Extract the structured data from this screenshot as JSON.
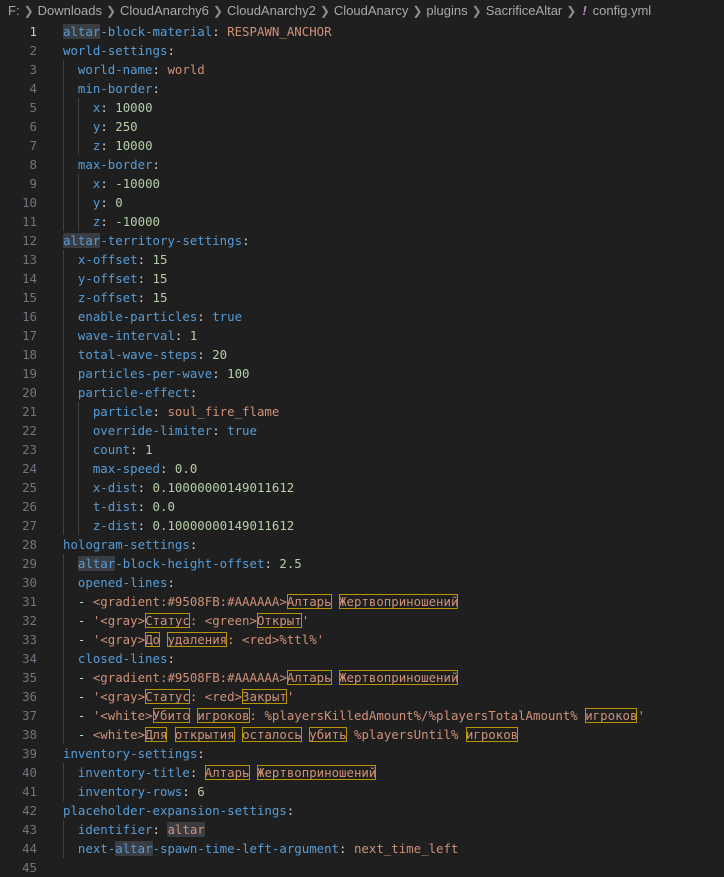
{
  "breadcrumb": {
    "items": [
      "F:",
      "Downloads",
      "CloudAnarchy6",
      "CloudAnarchy2",
      "CloudAnarcy",
      "plugins",
      "SacrificeAltar"
    ],
    "file_icon": "!",
    "file_name": "config.yml"
  },
  "colors": {
    "key": "#569cd6",
    "string": "#ce9178",
    "number": "#b5cea8",
    "punctuation": "#cccccc",
    "highlight_box": "#b89500",
    "background": "#1f1f1f"
  },
  "editor": {
    "active_line": 1,
    "lines": [
      {
        "n": "1",
        "indent": 0,
        "t": [
          [
            "k",
            "altar",
            "hl"
          ],
          [
            "k",
            "-block-material"
          ],
          [
            "p",
            ": "
          ],
          [
            "s",
            "RESPAWN_ANCHOR"
          ]
        ]
      },
      {
        "n": "2",
        "indent": 0,
        "t": [
          [
            "k",
            "world-settings"
          ],
          [
            "p",
            ":"
          ]
        ]
      },
      {
        "n": "3",
        "indent": 1,
        "t": [
          [
            "k",
            "world-name"
          ],
          [
            "p",
            ": "
          ],
          [
            "s",
            "world"
          ]
        ]
      },
      {
        "n": "4",
        "indent": 1,
        "t": [
          [
            "k",
            "min-border"
          ],
          [
            "p",
            ":"
          ]
        ]
      },
      {
        "n": "5",
        "indent": 2,
        "t": [
          [
            "k",
            "x"
          ],
          [
            "p",
            ": "
          ],
          [
            "n",
            "10000"
          ]
        ]
      },
      {
        "n": "6",
        "indent": 2,
        "t": [
          [
            "k",
            "y"
          ],
          [
            "p",
            ": "
          ],
          [
            "n",
            "250"
          ]
        ]
      },
      {
        "n": "7",
        "indent": 2,
        "t": [
          [
            "k",
            "z"
          ],
          [
            "p",
            ": "
          ],
          [
            "n",
            "10000"
          ]
        ]
      },
      {
        "n": "8",
        "indent": 1,
        "t": [
          [
            "k",
            "max-border"
          ],
          [
            "p",
            ":"
          ]
        ]
      },
      {
        "n": "9",
        "indent": 2,
        "t": [
          [
            "k",
            "x"
          ],
          [
            "p",
            ": "
          ],
          [
            "n",
            "-10000"
          ]
        ]
      },
      {
        "n": "10",
        "indent": 2,
        "t": [
          [
            "k",
            "y"
          ],
          [
            "p",
            ": "
          ],
          [
            "n",
            "0"
          ]
        ]
      },
      {
        "n": "11",
        "indent": 2,
        "t": [
          [
            "k",
            "z"
          ],
          [
            "p",
            ": "
          ],
          [
            "n",
            "-10000"
          ]
        ]
      },
      {
        "n": "12",
        "indent": 0,
        "t": [
          [
            "k",
            "altar",
            "hl"
          ],
          [
            "k",
            "-territory-settings"
          ],
          [
            "p",
            ":"
          ]
        ]
      },
      {
        "n": "13",
        "indent": 1,
        "t": [
          [
            "k",
            "x-offset"
          ],
          [
            "p",
            ": "
          ],
          [
            "n",
            "15"
          ]
        ]
      },
      {
        "n": "14",
        "indent": 1,
        "t": [
          [
            "k",
            "y-offset"
          ],
          [
            "p",
            ": "
          ],
          [
            "n",
            "15"
          ]
        ]
      },
      {
        "n": "15",
        "indent": 1,
        "t": [
          [
            "k",
            "z-offset"
          ],
          [
            "p",
            ": "
          ],
          [
            "n",
            "15"
          ]
        ]
      },
      {
        "n": "16",
        "indent": 1,
        "t": [
          [
            "k",
            "enable-particles"
          ],
          [
            "p",
            ": "
          ],
          [
            "b",
            "true"
          ]
        ]
      },
      {
        "n": "17",
        "indent": 1,
        "t": [
          [
            "k",
            "wave-interval"
          ],
          [
            "p",
            ": "
          ],
          [
            "n",
            "1"
          ]
        ]
      },
      {
        "n": "18",
        "indent": 1,
        "t": [
          [
            "k",
            "total-wave-steps"
          ],
          [
            "p",
            ": "
          ],
          [
            "n",
            "20"
          ]
        ]
      },
      {
        "n": "19",
        "indent": 1,
        "t": [
          [
            "k",
            "particles-per-wave"
          ],
          [
            "p",
            ": "
          ],
          [
            "n",
            "100"
          ]
        ]
      },
      {
        "n": "20",
        "indent": 1,
        "t": [
          [
            "k",
            "particle-effect"
          ],
          [
            "p",
            ":"
          ]
        ]
      },
      {
        "n": "21",
        "indent": 2,
        "t": [
          [
            "k",
            "particle"
          ],
          [
            "p",
            ": "
          ],
          [
            "s",
            "soul_fire_flame"
          ]
        ]
      },
      {
        "n": "22",
        "indent": 2,
        "t": [
          [
            "k",
            "override-limiter"
          ],
          [
            "p",
            ": "
          ],
          [
            "b",
            "true"
          ]
        ]
      },
      {
        "n": "23",
        "indent": 2,
        "t": [
          [
            "k",
            "count"
          ],
          [
            "p",
            ": "
          ],
          [
            "n",
            "1"
          ]
        ]
      },
      {
        "n": "24",
        "indent": 2,
        "t": [
          [
            "k",
            "max-speed"
          ],
          [
            "p",
            ": "
          ],
          [
            "n",
            "0.0"
          ]
        ]
      },
      {
        "n": "25",
        "indent": 2,
        "t": [
          [
            "k",
            "x-dist"
          ],
          [
            "p",
            ": "
          ],
          [
            "n",
            "0.10000000149011612"
          ]
        ]
      },
      {
        "n": "26",
        "indent": 2,
        "t": [
          [
            "k",
            "t-dist"
          ],
          [
            "p",
            ": "
          ],
          [
            "n",
            "0.0"
          ]
        ]
      },
      {
        "n": "27",
        "indent": 2,
        "t": [
          [
            "k",
            "z-dist"
          ],
          [
            "p",
            ": "
          ],
          [
            "n",
            "0.10000000149011612"
          ]
        ]
      },
      {
        "n": "28",
        "indent": 0,
        "t": [
          [
            "k",
            "hologram-settings"
          ],
          [
            "p",
            ":"
          ]
        ]
      },
      {
        "n": "29",
        "indent": 1,
        "t": [
          [
            "k",
            "altar",
            "hl"
          ],
          [
            "k",
            "-block-height-offset"
          ],
          [
            "p",
            ": "
          ],
          [
            "n",
            "2.5"
          ]
        ]
      },
      {
        "n": "30",
        "indent": 1,
        "t": [
          [
            "k",
            "opened-lines"
          ],
          [
            "p",
            ":"
          ]
        ]
      },
      {
        "n": "31",
        "indent": 1,
        "t": [
          [
            "p",
            "- "
          ],
          [
            "s",
            "<gradient:#9508FB:#AAAAAA>"
          ],
          [
            "s",
            "Алтарь",
            "box"
          ],
          [
            "s",
            " "
          ],
          [
            "s",
            "Жертвоприношений",
            "box"
          ]
        ]
      },
      {
        "n": "32",
        "indent": 1,
        "t": [
          [
            "p",
            "- "
          ],
          [
            "s",
            "'<gray>"
          ],
          [
            "s",
            "Статус",
            "box"
          ],
          [
            "s",
            ": <green>"
          ],
          [
            "s",
            "Открыт",
            "box"
          ],
          [
            "s",
            "'"
          ]
        ]
      },
      {
        "n": "33",
        "indent": 1,
        "t": [
          [
            "p",
            "- "
          ],
          [
            "s",
            "'<gray>"
          ],
          [
            "s",
            "До",
            "box"
          ],
          [
            "s",
            " "
          ],
          [
            "s",
            "удаления",
            "box"
          ],
          [
            "s",
            ": <red>%ttl%'"
          ]
        ]
      },
      {
        "n": "34",
        "indent": 1,
        "t": [
          [
            "k",
            "closed-lines"
          ],
          [
            "p",
            ":"
          ]
        ]
      },
      {
        "n": "35",
        "indent": 1,
        "t": [
          [
            "p",
            "- "
          ],
          [
            "s",
            "<gradient:#9508FB:#AAAAAA>"
          ],
          [
            "s",
            "Алтарь",
            "box"
          ],
          [
            "s",
            " "
          ],
          [
            "s",
            "Жертвоприношений",
            "box"
          ]
        ]
      },
      {
        "n": "36",
        "indent": 1,
        "t": [
          [
            "p",
            "- "
          ],
          [
            "s",
            "'<gray>"
          ],
          [
            "s",
            "Статус",
            "box"
          ],
          [
            "s",
            ": <red>"
          ],
          [
            "s",
            "Закрыт",
            "box"
          ],
          [
            "s",
            "'"
          ]
        ]
      },
      {
        "n": "37",
        "indent": 1,
        "t": [
          [
            "p",
            "- "
          ],
          [
            "s",
            "'<white>"
          ],
          [
            "s",
            "Убито",
            "box"
          ],
          [
            "s",
            " "
          ],
          [
            "s",
            "игроков",
            "box"
          ],
          [
            "s",
            ": %playersKilledAmount%/%playersTotalAmount% "
          ],
          [
            "s",
            "игроков",
            "box"
          ],
          [
            "s",
            "'"
          ]
        ]
      },
      {
        "n": "38",
        "indent": 1,
        "t": [
          [
            "p",
            "- "
          ],
          [
            "s",
            "<white>"
          ],
          [
            "s",
            "Для",
            "box"
          ],
          [
            "s",
            " "
          ],
          [
            "s",
            "открытия",
            "box"
          ],
          [
            "s",
            " "
          ],
          [
            "s",
            "осталось",
            "box"
          ],
          [
            "s",
            " "
          ],
          [
            "s",
            "убить",
            "box"
          ],
          [
            "s",
            " %playersUntil% "
          ],
          [
            "s",
            "игроков",
            "box"
          ]
        ]
      },
      {
        "n": "39",
        "indent": 0,
        "t": [
          [
            "k",
            "inventory-settings"
          ],
          [
            "p",
            ":"
          ]
        ]
      },
      {
        "n": "40",
        "indent": 1,
        "t": [
          [
            "k",
            "inventory-title"
          ],
          [
            "p",
            ": "
          ],
          [
            "s",
            "Алтарь",
            "box"
          ],
          [
            "s",
            " "
          ],
          [
            "s",
            "Жертвоприношений",
            "box"
          ]
        ]
      },
      {
        "n": "41",
        "indent": 1,
        "t": [
          [
            "k",
            "inventory-rows"
          ],
          [
            "p",
            ": "
          ],
          [
            "n",
            "6"
          ]
        ]
      },
      {
        "n": "42",
        "indent": 0,
        "t": [
          [
            "k",
            "placeholder-expansion-settings"
          ],
          [
            "p",
            ":"
          ]
        ]
      },
      {
        "n": "43",
        "indent": 1,
        "t": [
          [
            "k",
            "identifier"
          ],
          [
            "p",
            ": "
          ],
          [
            "s",
            "altar",
            "hl"
          ]
        ]
      },
      {
        "n": "44",
        "indent": 1,
        "t": [
          [
            "k",
            "next-"
          ],
          [
            "k",
            "altar",
            "hl"
          ],
          [
            "k",
            "-spawn-time-left-argument"
          ],
          [
            "p",
            ": "
          ],
          [
            "s",
            "next_time_left"
          ]
        ]
      },
      {
        "n": "45",
        "indent": 0,
        "t": []
      }
    ]
  }
}
